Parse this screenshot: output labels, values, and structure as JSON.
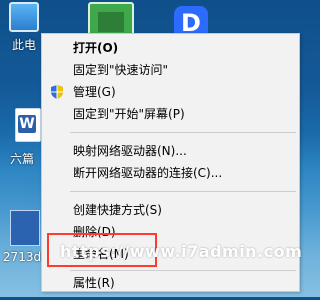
{
  "desktop": {
    "icons": [
      {
        "label": "此电"
      },
      {
        "label": "六篇"
      },
      {
        "label": "2713d"
      }
    ],
    "app_letter": "D"
  },
  "context_menu": {
    "items": [
      {
        "label": "打开(O)"
      },
      {
        "label": "固定到\"快速访问\""
      },
      {
        "label": "管理(G)"
      },
      {
        "label": "固定到\"开始\"屏幕(P)"
      },
      {
        "label": "映射网络驱动器(N)..."
      },
      {
        "label": "断开网络驱动器的连接(C)..."
      },
      {
        "label": "创建快捷方式(S)"
      },
      {
        "label": "删除(D)"
      },
      {
        "label": "重命名(M)"
      },
      {
        "label": "属性(R)"
      }
    ]
  },
  "watermark": "https://www.i7admin.com",
  "colors": {
    "menu_bg": "#f2f2f2",
    "highlight": "#ff3b30"
  }
}
